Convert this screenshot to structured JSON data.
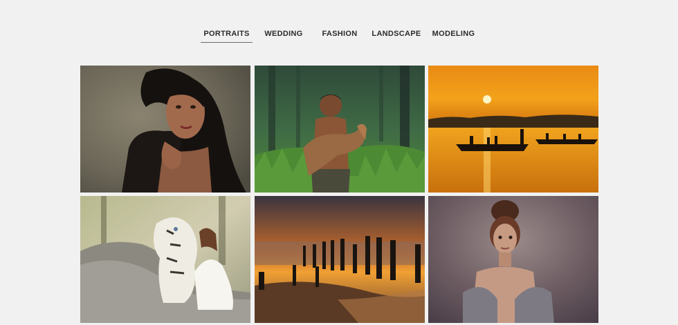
{
  "filter_tabs": [
    {
      "label": "PORTRAITS",
      "active": true
    },
    {
      "label": "WEDDING",
      "active": false
    },
    {
      "label": "FASHION",
      "active": false
    },
    {
      "label": "LANDSCAPE",
      "active": false
    },
    {
      "label": "MODELING",
      "active": false
    }
  ],
  "gallery": {
    "photos": [
      {
        "subject": "woman-portrait-dark-hair"
      },
      {
        "subject": "boy-holding-goat-in-forest"
      },
      {
        "subject": "sunset-river-boats"
      },
      {
        "subject": "woman-with-white-tiger"
      },
      {
        "subject": "beach-pier-posts-at-sunset"
      },
      {
        "subject": "woman-with-hair-bun"
      }
    ]
  },
  "colors": {
    "background": "#f1f1f1",
    "tab_text": "#2b2b2b",
    "active_underline": "#6b6b6b"
  }
}
